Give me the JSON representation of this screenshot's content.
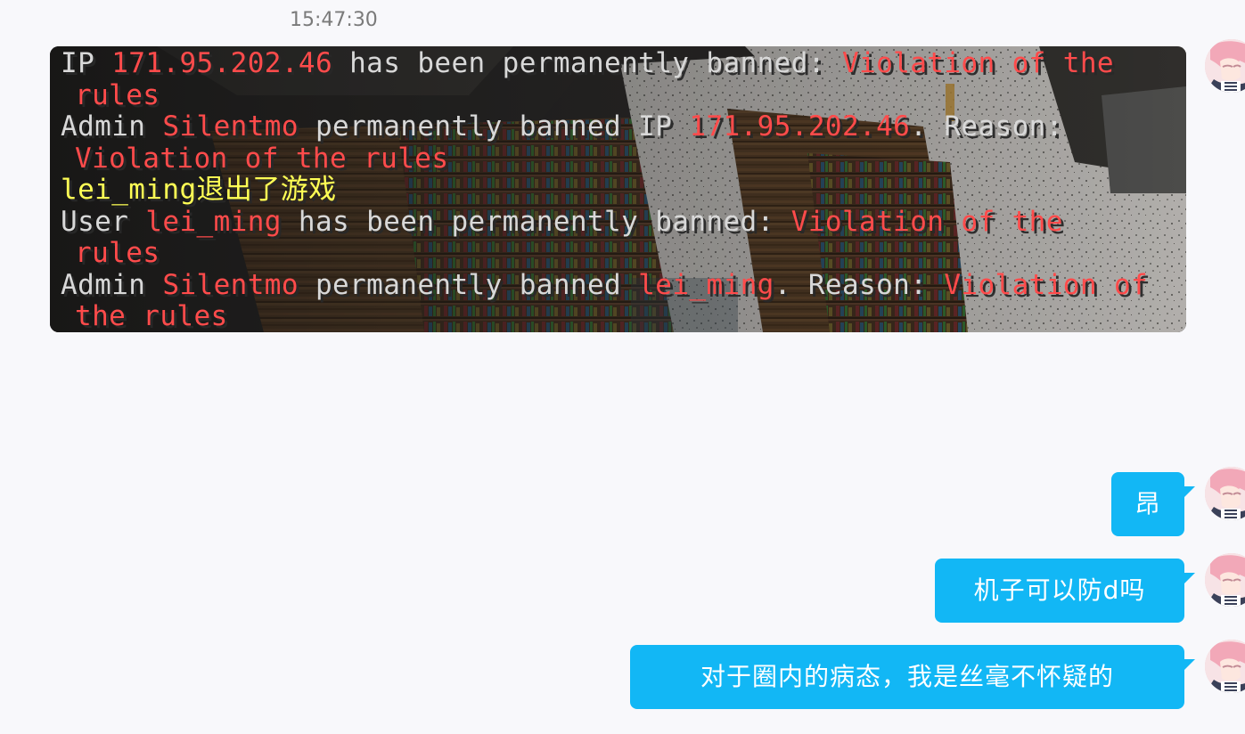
{
  "timestamp": "15:47:30",
  "messages": {
    "image": {
      "lines": [
        {
          "segments": [
            {
              "text": "IP ",
              "color": "#d8d8d8"
            },
            {
              "text": "171.95.202.46",
              "color": "#ff4b4b"
            },
            {
              "text": " has been permanently banned: ",
              "color": "#d8d8d8"
            },
            {
              "text": "Violation of the",
              "color": "#ff4b4b"
            }
          ]
        },
        {
          "indent": true,
          "segments": [
            {
              "text": "rules",
              "color": "#ff4b4b"
            }
          ]
        },
        {
          "segments": [
            {
              "text": "Admin ",
              "color": "#d8d8d8"
            },
            {
              "text": "Silentmo",
              "color": "#ff4b4b"
            },
            {
              "text": " permanently banned IP ",
              "color": "#d8d8d8"
            },
            {
              "text": "171.95.202.46",
              "color": "#ff4b4b"
            },
            {
              "text": ". Reason:",
              "color": "#d8d8d8"
            }
          ]
        },
        {
          "indent": true,
          "segments": [
            {
              "text": "Violation of the rules",
              "color": "#ff4b4b"
            }
          ]
        },
        {
          "segments": [
            {
              "text": "lei_ming",
              "color": "#ffff55"
            },
            {
              "text": "退出了游戏",
              "color": "#ffff55"
            }
          ]
        },
        {
          "segments": [
            {
              "text": "User ",
              "color": "#d8d8d8"
            },
            {
              "text": "lei_ming",
              "color": "#ff4b4b"
            },
            {
              "text": " has been permanently banned: ",
              "color": "#d8d8d8"
            },
            {
              "text": "Violation of the",
              "color": "#ff4b4b"
            }
          ]
        },
        {
          "indent": true,
          "segments": [
            {
              "text": "rules",
              "color": "#ff4b4b"
            }
          ]
        },
        {
          "segments": [
            {
              "text": "Admin ",
              "color": "#d8d8d8"
            },
            {
              "text": "Silentmo",
              "color": "#ff4b4b"
            },
            {
              "text": " permanently banned ",
              "color": "#d8d8d8"
            },
            {
              "text": "lei_ming",
              "color": "#ff4b4b"
            },
            {
              "text": ". Reason: ",
              "color": "#d8d8d8"
            },
            {
              "text": "Violation of",
              "color": "#ff4b4b"
            }
          ]
        },
        {
          "indent": true,
          "segments": [
            {
              "text": "the rules",
              "color": "#ff4b4b"
            }
          ]
        }
      ]
    },
    "bubble_1": "昂",
    "bubble_2": "机子可以防d吗",
    "bubble_3": "对于圈内的病态，我是丝毫不怀疑的"
  },
  "colors": {
    "bubble": "#12b7f5",
    "page_background": "#f8f8fb",
    "timestamp": "#7a7a7a"
  }
}
